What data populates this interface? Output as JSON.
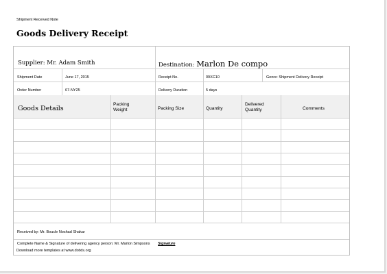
{
  "header": {
    "top_note": "Shipment Received Note",
    "title": "Goods Delivery Receipt"
  },
  "supplier": {
    "label": "Supplier:",
    "value": "Mr. Adam Smith"
  },
  "destination": {
    "label": "Destination:",
    "value": "Marlon De compo"
  },
  "details": {
    "shipment_date_label": "Shipment Date",
    "shipment_date_value": "June 17, 2015",
    "order_number_label": "Order Number",
    "order_number_value": "67-NY25",
    "receipt_no_label": "Receipt No.",
    "receipt_no_value": "09XC10",
    "delivery_duration_label": "Delivery Duration",
    "delivery_duration_value": "5 days",
    "genre": "Genre: Shipment Delivery Receipt"
  },
  "table": {
    "headers": {
      "goods": "Goods Details",
      "packing_weight_1": "Packing",
      "packing_weight_2": "Weight",
      "packing_size": "Packing Size",
      "quantity": "Quantity",
      "delivered_1": "Delivered",
      "delivered_2": "Quantity",
      "comments": "Comments"
    }
  },
  "footer": {
    "received_by": "Received  by: Mr. Boucle Noshad Shakar",
    "agency_sign": "Complete Name & Signature of delivering agency person: Mr. Marlon Simpsons",
    "signature": "Signature",
    "download": "Download more templates at www.dotxls.org"
  }
}
